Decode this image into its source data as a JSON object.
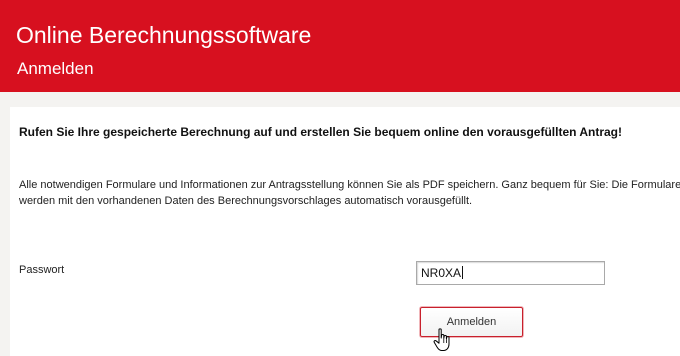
{
  "header": {
    "title": "Online Berechnungssoftware",
    "subtitle": "Anmelden"
  },
  "main": {
    "intro_bold": "Rufen Sie Ihre gespeicherte Berechnung auf und erstellen Sie bequem online den vorausgefüllten Antrag!",
    "intro_text": "Alle notwendigen Formulare und Informationen zur Antragsstellung können Sie als PDF speichern. Ganz bequem für Sie: Die Formulare werden mit den vorhandenen Daten des Berechnungsvorschlages automatisch vorausgefüllt.",
    "password_label": "Passwort",
    "password_value": "NR0XA",
    "login_button_label": "Anmelden"
  },
  "colors": {
    "header_red": "#d7101f",
    "page_bg": "#f4f3f1",
    "content_bg": "#ffffff"
  },
  "icons": {
    "cursor": "hand-pointer-icon"
  }
}
